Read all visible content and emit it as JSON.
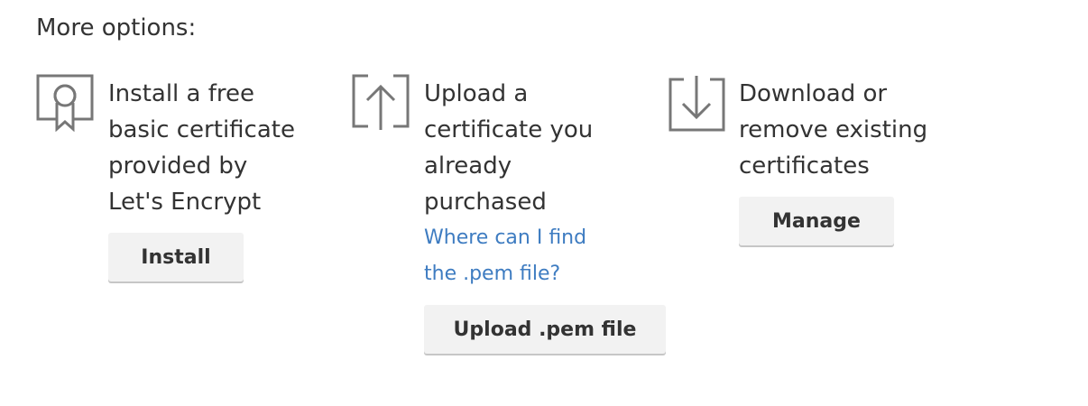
{
  "heading": "More options:",
  "options": [
    {
      "icon": "certificate-ribbon-icon",
      "description": "Install a free\nbasic certificate\nprovided by\nLet's Encrypt",
      "button_label": "Install"
    },
    {
      "icon": "upload-arrow-icon",
      "description": "Upload a\ncertificate you\nalready\npurchased",
      "help_link": "Where can I find\nthe .pem file?",
      "button_label": "Upload .pem file"
    },
    {
      "icon": "download-arrow-icon",
      "description": "Download or\nremove existing\ncertificates",
      "button_label": "Manage"
    }
  ],
  "colors": {
    "text": "#333333",
    "link": "#3e7cc1",
    "icon": "#777777",
    "button_bg": "#f2f2f2"
  }
}
